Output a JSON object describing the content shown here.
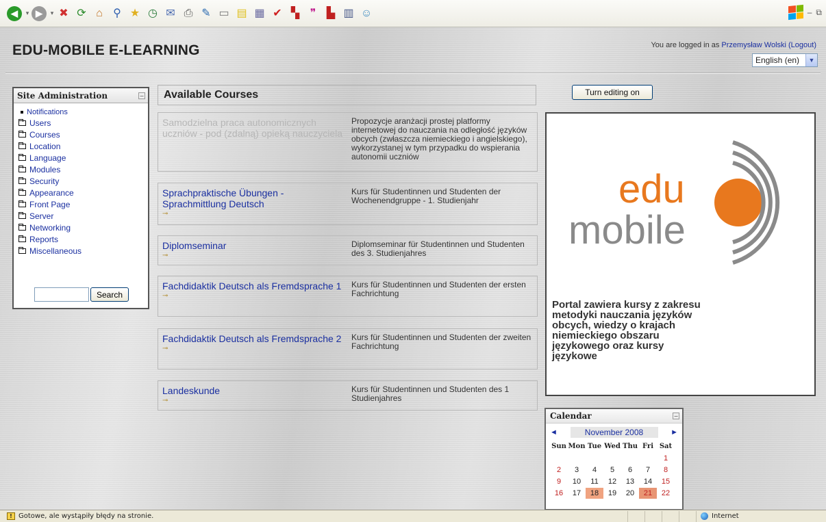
{
  "toolbar": {
    "icons": [
      "back-icon",
      "forward-icon",
      "stop-icon",
      "refresh-icon",
      "home-icon",
      "search-icon",
      "favorites-icon",
      "history-icon",
      "mail-icon",
      "print-icon",
      "edit-icon",
      "discuss-icon",
      "notes-icon",
      "research-icon",
      "check-icon",
      "flag-icon",
      "quote-icon",
      "translate-icon",
      "books-icon",
      "messenger-icon"
    ]
  },
  "site": {
    "title": "EDU-MOBILE E-LEARNING",
    "login_prefix": "You are logged in as ",
    "user_name": "Przemysław Wolski",
    "logout_label": "(Logout)",
    "language": "English (en)"
  },
  "admin": {
    "title": "Site Administration",
    "items": [
      {
        "label": "Notifications",
        "type": "bullet"
      },
      {
        "label": "Users",
        "type": "folder"
      },
      {
        "label": "Courses",
        "type": "folder"
      },
      {
        "label": "Location",
        "type": "folder"
      },
      {
        "label": "Language",
        "type": "folder"
      },
      {
        "label": "Modules",
        "type": "folder"
      },
      {
        "label": "Security",
        "type": "folder"
      },
      {
        "label": "Appearance",
        "type": "folder"
      },
      {
        "label": "Front Page",
        "type": "folder"
      },
      {
        "label": "Server",
        "type": "folder"
      },
      {
        "label": "Networking",
        "type": "folder"
      },
      {
        "label": "Reports",
        "type": "folder"
      },
      {
        "label": "Miscellaneous",
        "type": "folder"
      }
    ],
    "search_value": "",
    "search_button": "Search"
  },
  "courses": {
    "title": "Available Courses",
    "items": [
      {
        "name": "Samodzielna praca autonomicznych uczniów - pod (zdalną) opieką nauczyciela",
        "desc": "Propozycje aranżacji prostej platformy internetowej do nauczania na odległość języków obcych (zwłaszcza niemieckiego i angielskiego), wykorzystanej w tym przypadku do wspierania autonomii uczniów",
        "dimmed": true,
        "key": false
      },
      {
        "name": "Sprachpraktische Übungen - Sprachmittlung Deutsch",
        "desc": "Kurs für Studentinnen und Studenten der Wochenendgruppe - 1. Studienjahr",
        "dimmed": false,
        "key": true
      },
      {
        "name": "Diplomseminar",
        "desc": "Diplomseminar für Studentinnen und Studenten des 3. Studienjahres",
        "dimmed": false,
        "key": true
      },
      {
        "name": "Fachdidaktik Deutsch als Fremdsprache 1",
        "desc": "Kurs für Studentinnen und Studenten der ersten Fachrichtung",
        "dimmed": false,
        "key": true
      },
      {
        "name": "Fachdidaktik Deutsch als Fremdsprache 2",
        "desc": "Kurs für Studentinnen und Studenten der zweiten Fachrichtung",
        "dimmed": false,
        "key": true
      },
      {
        "name": "Landeskunde",
        "desc": "Kurs für Studentinnen und Studenten des 1 Studienjahres",
        "dimmed": false,
        "key": true
      }
    ]
  },
  "right": {
    "edit_button": "Turn editing on",
    "logo_line1": "edu",
    "logo_line2": "mobile",
    "promo_text": "Portal zawiera kursy z zakresu metodyki nauczania języków obcych, wiedzy o krajach niemieckiego obszaru językowego oraz kursy językowe"
  },
  "calendar": {
    "title": "Calendar",
    "month": "November 2008",
    "prev": "◄",
    "next": "►",
    "dow": [
      "Sun",
      "Mon",
      "Tue",
      "Wed",
      "Thu",
      "Fri",
      "Sat"
    ],
    "weeks": [
      [
        "",
        "",
        "",
        "",
        "",
        "",
        "1"
      ],
      [
        "2",
        "3",
        "4",
        "5",
        "6",
        "7",
        "8"
      ],
      [
        "9",
        "10",
        "11",
        "12",
        "13",
        "14",
        "15"
      ],
      [
        "16",
        "17",
        "18",
        "19",
        "20",
        "21",
        "22"
      ]
    ],
    "highlighted": [
      "18",
      "21"
    ]
  },
  "status": {
    "message": "Gotowe, ale wystąpiły błędy na stronie.",
    "zone": "Internet"
  },
  "colors": {
    "link": "#1a2fa0",
    "logo_orange": "#e8781e",
    "logo_gray": "#8a8a8a"
  }
}
